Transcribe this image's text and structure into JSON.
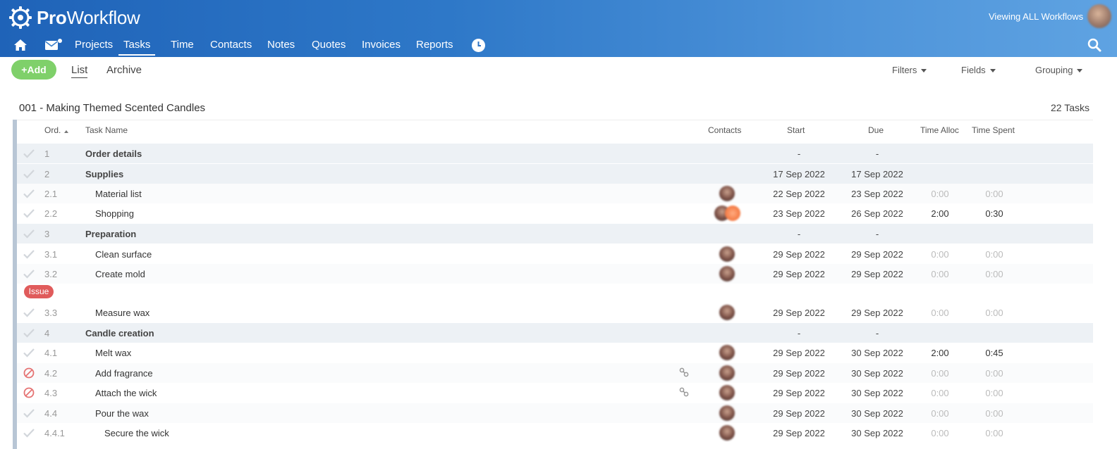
{
  "app": {
    "logo_bold": "Pro",
    "logo_rest": "Workflow",
    "viewing_text": "Viewing ALL Workflows"
  },
  "nav": {
    "items": [
      {
        "label": "Projects"
      },
      {
        "label": "Tasks",
        "active": true
      },
      {
        "label": "Time"
      },
      {
        "label": "Contacts"
      },
      {
        "label": "Notes"
      },
      {
        "label": "Quotes"
      },
      {
        "label": "Invoices"
      },
      {
        "label": "Reports"
      }
    ]
  },
  "toolbar": {
    "add_label": "Add",
    "tabs": [
      {
        "label": "List",
        "active": true
      },
      {
        "label": "Archive"
      }
    ],
    "filters_label": "Filters",
    "fields_label": "Fields",
    "grouping_label": "Grouping"
  },
  "project": {
    "title": "001 - Making Themed Scented Candles",
    "task_count": "22 Tasks"
  },
  "columns": {
    "ord": "Ord.",
    "task_name": "Task Name",
    "contacts": "Contacts",
    "start": "Start",
    "due": "Due",
    "time_alloc": "Time Alloc",
    "time_spent": "Time Spent"
  },
  "rows": [
    {
      "ord": "1",
      "name": "Order details",
      "group": true,
      "start": "-",
      "due": "-",
      "alloc": "",
      "spent": ""
    },
    {
      "ord": "2",
      "name": "Supplies",
      "group": true,
      "start": "17 Sep 2022",
      "due": "17 Sep 2022",
      "alloc": "",
      "spent": ""
    },
    {
      "ord": "2.1",
      "name": "Material list",
      "start": "22 Sep 2022",
      "due": "23 Sep 2022",
      "alloc": "0:00",
      "spent": "0:00"
    },
    {
      "ord": "2.2",
      "name": "Shopping",
      "start": "23 Sep 2022",
      "due": "26 Sep 2022",
      "alloc": "2:00",
      "spent": "0:30"
    },
    {
      "ord": "3",
      "name": "Preparation",
      "group": true,
      "start": "-",
      "due": "-",
      "alloc": "",
      "spent": ""
    },
    {
      "ord": "3.1",
      "name": "Clean surface",
      "start": "29 Sep 2022",
      "due": "29 Sep 2022",
      "alloc": "0:00",
      "spent": "0:00"
    },
    {
      "ord": "3.2",
      "name": "Create mold",
      "start": "29 Sep 2022",
      "due": "29 Sep 2022",
      "alloc": "0:00",
      "spent": "0:00"
    },
    {
      "ord": "3.3",
      "name": "Measure wax",
      "start": "29 Sep 2022",
      "due": "29 Sep 2022",
      "alloc": "0:00",
      "spent": "0:00"
    },
    {
      "ord": "4",
      "name": "Candle creation",
      "group": true,
      "start": "-",
      "due": "-",
      "alloc": "",
      "spent": ""
    },
    {
      "ord": "4.1",
      "name": "Melt wax",
      "start": "29 Sep 2022",
      "due": "30 Sep 2022",
      "alloc": "2:00",
      "spent": "0:45"
    },
    {
      "ord": "4.2",
      "name": "Add fragrance",
      "blocked": true,
      "start": "29 Sep 2022",
      "due": "30 Sep 2022",
      "alloc": "0:00",
      "spent": "0:00"
    },
    {
      "ord": "4.3",
      "name": "Attach the wick",
      "blocked": true,
      "start": "29 Sep 2022",
      "due": "30 Sep 2022",
      "alloc": "0:00",
      "spent": "0:00"
    },
    {
      "ord": "4.4",
      "name": "Pour the wax",
      "start": "29 Sep 2022",
      "due": "30 Sep 2022",
      "alloc": "0:00",
      "spent": "0:00"
    },
    {
      "ord": "4.4.1",
      "name": "Secure the wick",
      "start": "29 Sep 2022",
      "due": "30 Sep 2022",
      "alloc": "0:00",
      "spent": "0:00"
    }
  ],
  "issue_label": "Issue"
}
